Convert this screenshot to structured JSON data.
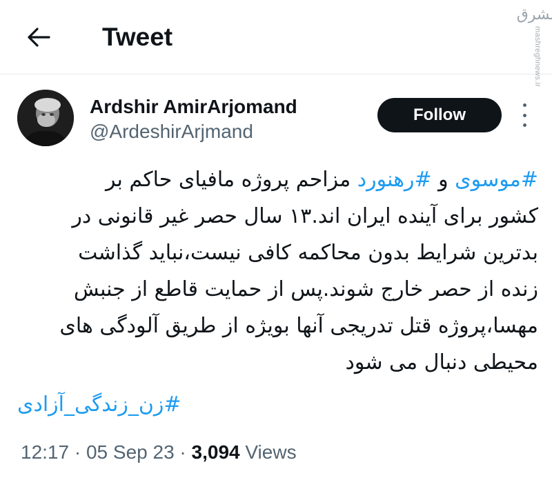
{
  "header": {
    "title": "Tweet",
    "back_icon": "arrow-left-icon",
    "watermark_logo": "مشرق",
    "watermark_url": "mashreghnews.ir"
  },
  "author": {
    "name": "Ardshir AmirArjomand",
    "handle": "@ArdeshirArjmand",
    "follow_label": "Follow",
    "avatar_icon": "avatar-photo"
  },
  "tweet": {
    "hashtag_1": "#موسوی",
    "connector": " و  ",
    "hashtag_2": "#رهنورد",
    "line_1_rest": " مزاحم پروژه مافیای حاکم بر",
    "line_2": "کشور برای آینده ایران اند.۱۳ سال حصر غیر قانونی در",
    "line_3": "بدترین شرایط بدون محاکمه کافی نیست،نباید گذاشت",
    "line_4": "زنده از حصر خارج شوند.پس از حمایت قاطع از جنبش",
    "line_5": "مهسا،پروژه قتل تدریجی آنها بویژه از طریق آلودگی های",
    "line_6": "محیطی دنبال می شود",
    "hashtag_3": "#زن_زندگی_آزادی"
  },
  "meta": {
    "time": "12:17",
    "separator": " · ",
    "date": "05 Sep 23",
    "views_count": "3,094",
    "views_label": " Views"
  },
  "colors": {
    "text": "#0f1419",
    "secondary": "#536471",
    "link": "#1d9bf0",
    "button_bg": "#0f1419",
    "button_text": "#ffffff"
  }
}
